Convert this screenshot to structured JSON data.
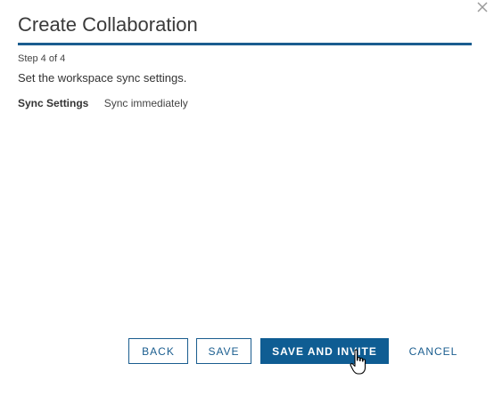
{
  "dialog": {
    "title": "Create Collaboration",
    "close_icon": "close-icon",
    "step": "Step 4 of 4",
    "instructions": "Set the workspace sync settings."
  },
  "settings": {
    "label": "Sync Settings",
    "value": "Sync immediately"
  },
  "footer": {
    "back_label": "BACK",
    "save_label": "SAVE",
    "save_invite_label": "SAVE AND INVITE",
    "cancel_label": "CANCEL"
  },
  "colors": {
    "accent": "#1a5d8f",
    "primary_button": "#0f5d93"
  }
}
